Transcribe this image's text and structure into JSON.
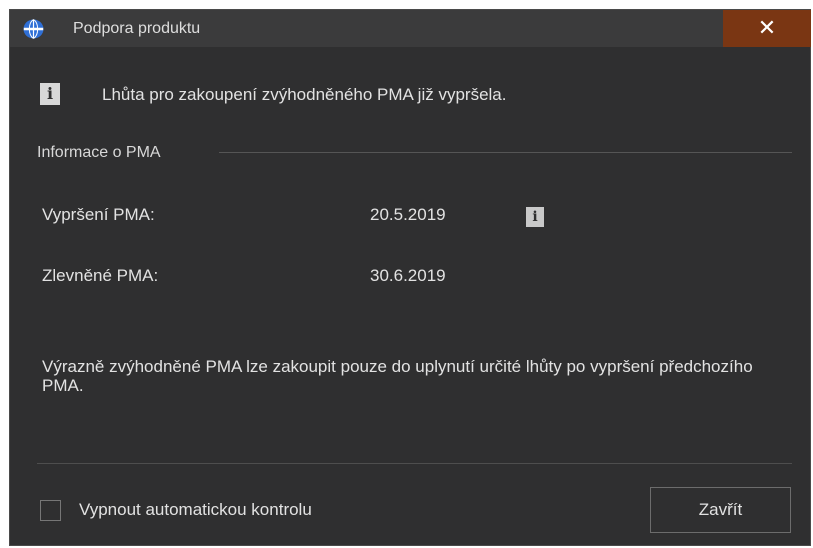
{
  "window": {
    "title": "Podpora produktu",
    "close_glyph": "✕",
    "app_icon": "globe-icon",
    "colors": {
      "background": "#2f2f30",
      "titlebar": "#3b3b3c",
      "close_button": "#7a3613",
      "text": "#e2e2e2"
    }
  },
  "notice": {
    "icon": "info-icon",
    "icon_glyph": "i",
    "text": "Lhůta pro zakoupení zvýhodněného PMA již vypršela."
  },
  "pma_group": {
    "label": "Informace o PMA",
    "expiry_label": "Vypršení PMA:",
    "expiry_value": "20.5.2019",
    "expiry_info_icon": "info-icon",
    "expiry_info_glyph": "i",
    "discount_label": "Zlevněné PMA:",
    "discount_value": "30.6.2019"
  },
  "description": "Výrazně zvýhodněné PMA lze zakoupit pouze do uplynutí určité lhůty po vypršení předchozího PMA.",
  "footer": {
    "checkbox_label": "Vypnout automatickou kontrolu",
    "checkbox_checked": false,
    "close_button_label": "Zavřít"
  }
}
